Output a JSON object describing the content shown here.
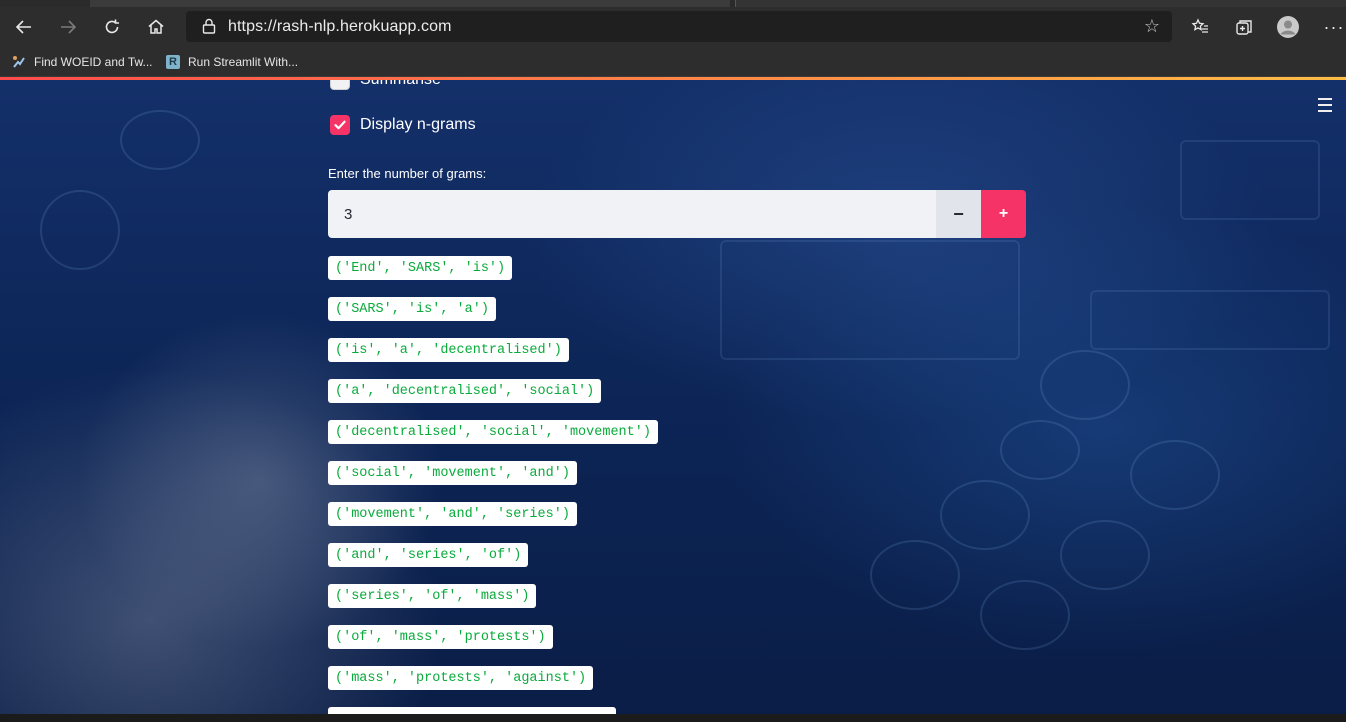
{
  "browser": {
    "url": "https://rash-nlp.herokuapp.com",
    "bookmarks": [
      {
        "label": "Find WOEID and Tw...",
        "icon": "tweet-tool-icon"
      },
      {
        "label": "Run Streamlit With...",
        "icon": "r-letter-icon",
        "icon_text": "R"
      }
    ]
  },
  "app": {
    "summarise_label": "Summarise",
    "summarise_checked": false,
    "ngrams_label": "Display n-grams",
    "ngrams_checked": true,
    "number_label": "Enter the number of grams:",
    "number_value": "3",
    "minus_label": "−",
    "plus_label": "+",
    "ngrams": [
      "('End', 'SARS', 'is')",
      "('SARS', 'is', 'a')",
      "('is', 'a', 'decentralised')",
      "('a', 'decentralised', 'social')",
      "('decentralised', 'social', 'movement')",
      "('social', 'movement', 'and')",
      "('movement', 'and', 'series')",
      "('and', 'series', 'of')",
      "('series', 'of', 'mass')",
      "('of', 'mass', 'protests')",
      "('mass', 'protests', 'against')"
    ]
  },
  "colors": {
    "accent": "#f63366",
    "ngram_text": "#09ab3b"
  }
}
